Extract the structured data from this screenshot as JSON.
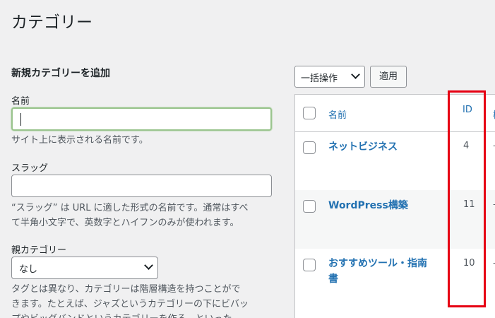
{
  "page": {
    "title": "カテゴリー"
  },
  "add_form": {
    "heading": "新規カテゴリーを追加",
    "name_label": "名前",
    "name_value": "",
    "name_desc": "サイト上に表示される名前です。",
    "slug_label": "スラッグ",
    "slug_value": "",
    "slug_desc_1": "“スラッグ” は URL に適した形式の名前です。通常はすべ",
    "slug_desc_2": "て半角小文字で、英数字とハイフンのみが使われます。",
    "parent_label": "親カテゴリー",
    "parent_selected": "なし",
    "parent_desc_1": "タグとは異なり、カテゴリーは階層構造を持つことがで",
    "parent_desc_2": "きます。たとえば、ジャズというカテゴリーの下にビバッ",
    "parent_desc_3": "プやビッグバンドというカテゴリーを作る、といった"
  },
  "list": {
    "bulk_action_label": "一括操作",
    "apply_label": "適用",
    "columns": {
      "name": "名前",
      "id": "ID",
      "extra": "樹"
    },
    "rows": [
      {
        "name": "ネットビジネス",
        "id": "4",
        "extra": "–"
      },
      {
        "name": "WordPress構築",
        "id": "11",
        "extra": "–"
      },
      {
        "name": "おすすめツール・指南書",
        "name_line1": "おすすめツール・指南",
        "name_line2": "書",
        "id": "10",
        "extra": "–"
      }
    ]
  },
  "colors": {
    "link": "#2271b1",
    "highlight": "#e60012",
    "background": "#f0f0f1"
  }
}
